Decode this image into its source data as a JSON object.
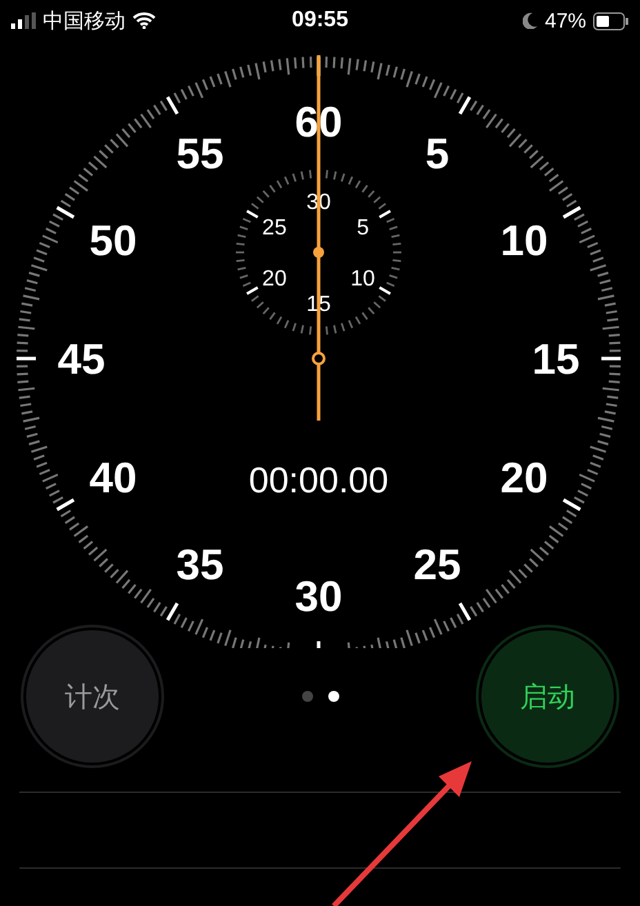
{
  "status_bar": {
    "carrier": "中国移动",
    "time": "09:55",
    "battery": "47%"
  },
  "dial": {
    "labels": [
      "60",
      "5",
      "10",
      "15",
      "20",
      "25",
      "30",
      "35",
      "40",
      "45",
      "50",
      "55"
    ],
    "sub_labels": [
      "30",
      "5",
      "10",
      "15",
      "20",
      "25"
    ],
    "time": "00:00.00"
  },
  "buttons": [
    {
      "label": "计次",
      "kind": "lap"
    },
    {
      "label": "启动",
      "kind": "start"
    }
  ],
  "page_dots": [
    {
      "selected": false
    },
    {
      "selected": true
    }
  ]
}
